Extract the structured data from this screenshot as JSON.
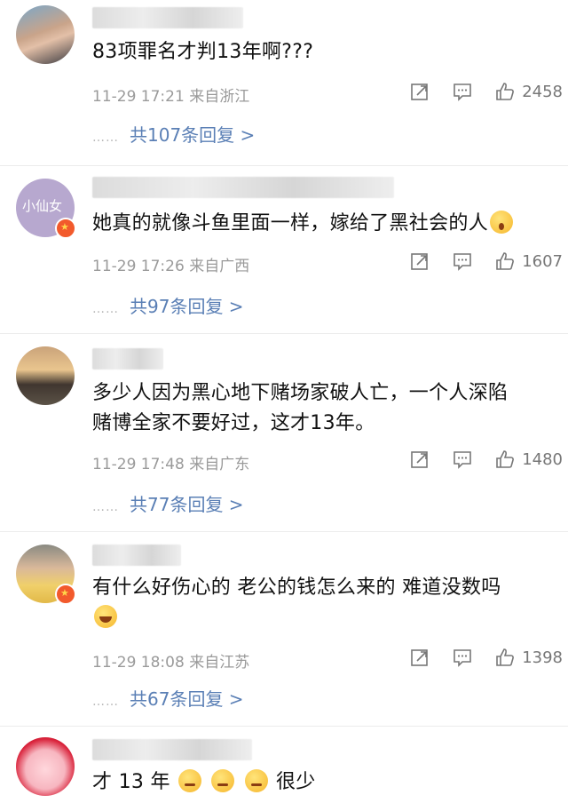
{
  "comments": [
    {
      "text": "83项罪名才判13年啊???",
      "time": "11-29 17:21",
      "location": "来自浙江",
      "likes": "2458",
      "replies": "共107条回复 >"
    },
    {
      "avatar_text": "小仙女",
      "text": "她真的就像斗鱼里面一样，嫁给了黑社会的人",
      "time": "11-29 17:26",
      "location": "来自广西",
      "likes": "1607",
      "replies": "共97条回复 >"
    },
    {
      "text_line1": "多少人因为黑心地下赌场家破人亡，一个人深陷",
      "text_line2": "赌博全家不要好过，这才13年。",
      "time": "11-29 17:48",
      "location": "来自广东",
      "likes": "1480",
      "replies": "共77条回复 >"
    },
    {
      "text": "有什么好伤心的 老公的钱怎么来的 难道没数吗",
      "time": "11-29 18:08",
      "location": "来自江苏",
      "likes": "1398",
      "replies": "共67条回复 >"
    },
    {
      "text_a": "才 13 年",
      "text_b": "很少"
    }
  ],
  "icons": {
    "share": "share-icon",
    "comment": "comment-icon",
    "like": "thumbs-up-icon"
  },
  "colors": {
    "reply_link": "#5a7fb5",
    "meta": "#9a9a9a"
  }
}
